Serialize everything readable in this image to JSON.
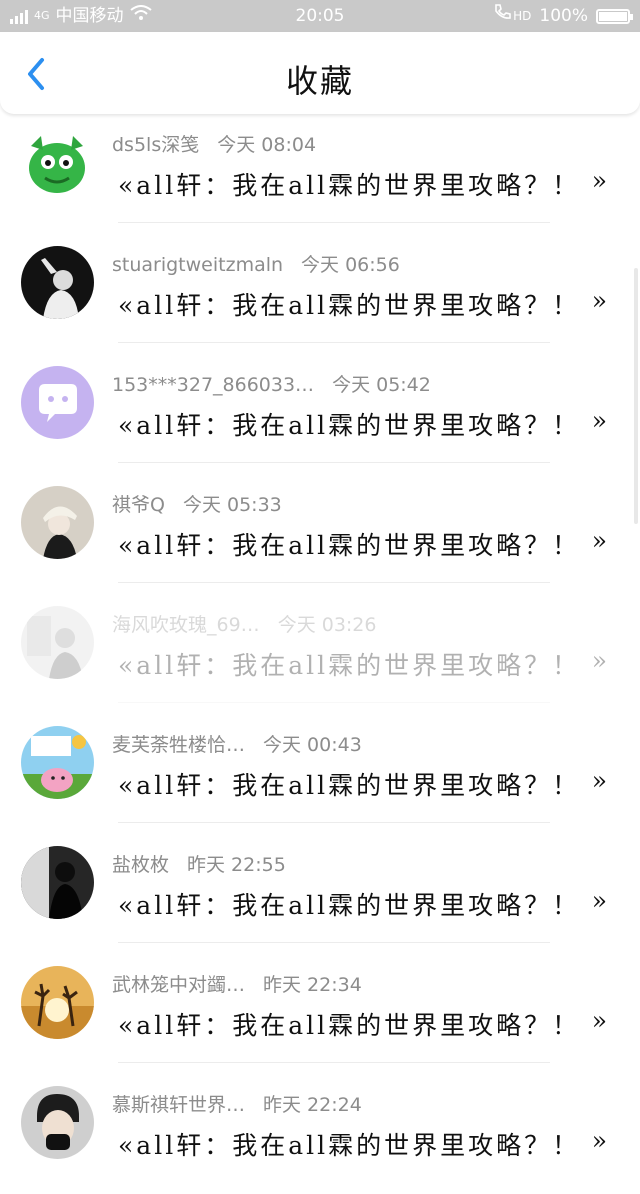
{
  "status": {
    "network": "4G",
    "carrier": "中国移动",
    "time": "20:05",
    "hd": "HD",
    "battery": "100%"
  },
  "header": {
    "title": "收藏",
    "back_icon": "chevron-left-icon"
  },
  "items": [
    {
      "user": "ds5ls深笺",
      "time": "今天 08:04",
      "text": "«all轩：我在all霖的世界里攻略？！",
      "end": "»",
      "avatar_bg": "#2fae3f"
    },
    {
      "user": "stuarigtweitzmaln",
      "time": "今天 06:56",
      "text": "«all轩：我在all霖的世界里攻略？！",
      "end": "»",
      "avatar_bg": "#1a1a1a"
    },
    {
      "user": "153***327_866033…",
      "time": "今天 05:42",
      "text": "«all轩：我在all霖的世界里攻略？！",
      "end": "»",
      "avatar_bg": "#c9b6f2"
    },
    {
      "user": "祺爷Q",
      "time": "今天 05:33",
      "text": "«all轩：我在all霖的世界里攻略？！",
      "end": "»",
      "avatar_bg": "#c8c2b8"
    },
    {
      "user": "海风吹玫瑰_69…",
      "time": "今天 03:26",
      "text": "«all轩：我在all霖的世界里攻略？！",
      "end": "»",
      "avatar_bg": "#b9b9b9"
    },
    {
      "user": "麦芙荼牲楼恰…",
      "time": "今天 00:43",
      "text": "«all轩：我在all霖的世界里攻略？！",
      "end": "»",
      "avatar_bg": "#8fd0f0"
    },
    {
      "user": "盐枚枚",
      "time": "昨天 22:55",
      "text": "«all轩：我在all霖的世界里攻略？！",
      "end": "»",
      "avatar_bg": "#2a2a2a"
    },
    {
      "user": "武林笼中对蠲…",
      "time": "昨天 22:34",
      "text": "«all轩：我在all霖的世界里攻略？！",
      "end": "»",
      "avatar_bg": "#e4a640"
    },
    {
      "user": "慕斯祺轩世界…",
      "time": "昨天 22:24",
      "text": "«all轩：我在all霖的世界里攻略？！",
      "end": "»",
      "avatar_bg": "#9a9a9a"
    }
  ]
}
